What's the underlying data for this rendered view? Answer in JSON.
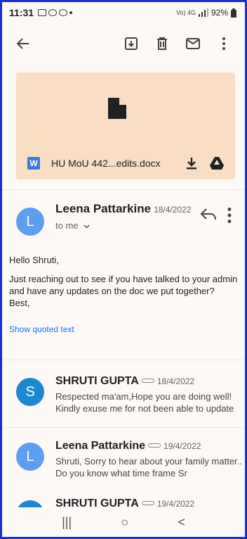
{
  "status_bar": {
    "time": "11:31",
    "battery": "92%",
    "net": "Vo) 4G"
  },
  "toolbar": {
    "back_icon": "arrow-left-icon",
    "archive_icon": "archive-icon",
    "delete_icon": "trash-icon",
    "mail_icon": "mail-icon",
    "more_icon": "more-vertical-icon"
  },
  "attachment": {
    "filename": "HU MoU 442...edits.docx",
    "badge": "W"
  },
  "message": {
    "avatar": "L",
    "sender": "Leena Pattarkine",
    "date": "18/4/2022",
    "recipients": "to me",
    "greeting": "Hello Shruti,",
    "body": "Just reaching out to see if you have talked to your admin and have any updates on the doc we put together?",
    "signoff": "Best,",
    "show_quoted": "Show quoted text"
  },
  "thread": [
    {
      "avatar": "S",
      "sender": "SHRUTI GUPTA",
      "date": "18/4/2022",
      "snippet": "Respected ma'am,Hope you are doing well! Kindly exuse me for not been able to update"
    },
    {
      "avatar": "L",
      "sender": "Leena Pattarkine",
      "date": "19/4/2022",
      "snippet": "Shruti, Sorry to hear about your family matter.. Do you know what time frame Sr"
    },
    {
      "avatar": "S",
      "sender": "SHRUTI GUPTA",
      "date": "19/4/2022",
      "snippet": ""
    }
  ],
  "navbar": {
    "recents": "|||",
    "home": "○",
    "back": "<"
  },
  "colors": {
    "attachment_bg": "#f9dec3",
    "avatar_l": "#5c9ef0",
    "avatar_s": "#1b88cf",
    "link": "#1a73e8",
    "border": "#1a2fd4"
  }
}
